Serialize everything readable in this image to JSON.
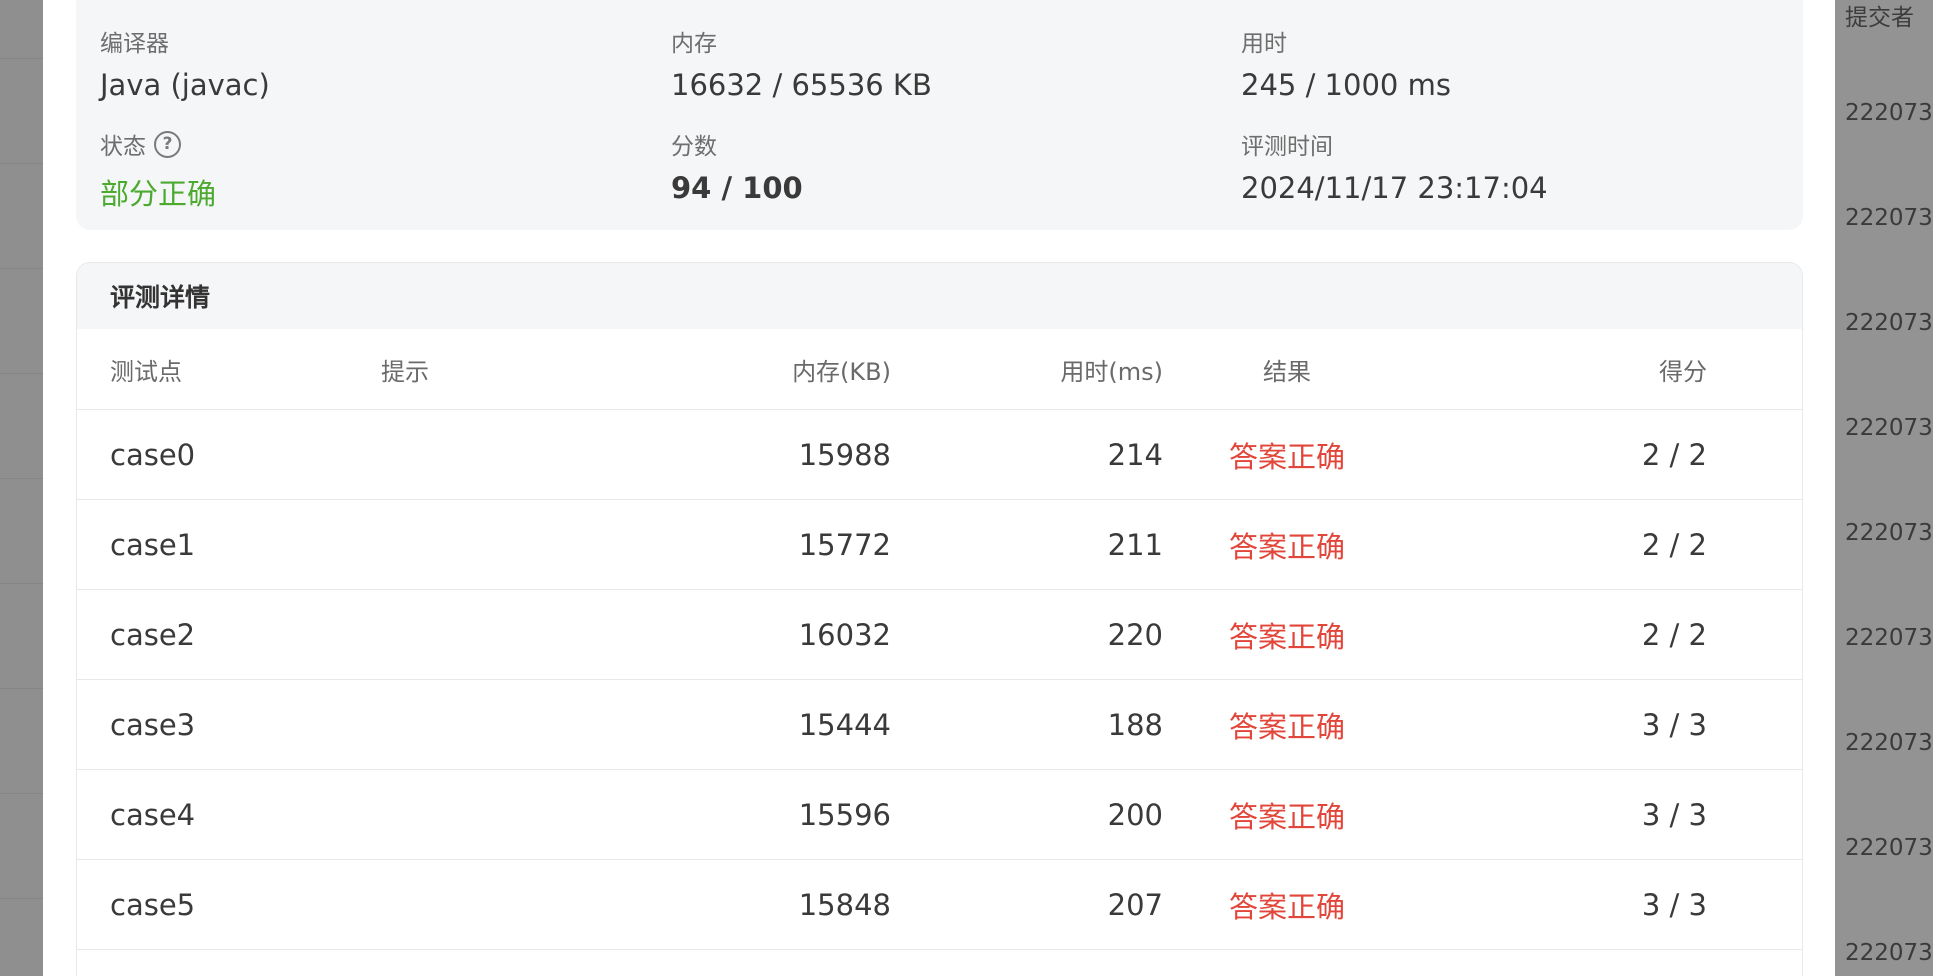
{
  "background": {
    "column_header": "提交者",
    "row_ids": [
      "222073",
      "222073",
      "222073",
      "222073",
      "222073",
      "222073",
      "222073",
      "222073",
      "222073"
    ]
  },
  "summary": {
    "compiler_label": "编译器",
    "compiler_value": "Java (javac)",
    "memory_label": "内存",
    "memory_value": "16632 / 65536 KB",
    "time_label": "用时",
    "time_value": "245 / 1000 ms",
    "status_label": "状态",
    "status_value": "部分正确",
    "score_label": "分数",
    "score_value": "94 / 100",
    "judge_time_label": "评测时间",
    "judge_time_value": "2024/11/17 23:17:04"
  },
  "details": {
    "title": "评测详情",
    "columns": {
      "case": "测试点",
      "hint": "提示",
      "memory": "内存(KB)",
      "time": "用时(ms)",
      "result": "结果",
      "score": "得分"
    },
    "rows": [
      {
        "case": "case0",
        "hint": "",
        "memory": "15988",
        "time": "214",
        "result": "答案正确",
        "score": "2 / 2"
      },
      {
        "case": "case1",
        "hint": "",
        "memory": "15772",
        "time": "211",
        "result": "答案正确",
        "score": "2 / 2"
      },
      {
        "case": "case2",
        "hint": "",
        "memory": "16032",
        "time": "220",
        "result": "答案正确",
        "score": "2 / 2"
      },
      {
        "case": "case3",
        "hint": "",
        "memory": "15444",
        "time": "188",
        "result": "答案正确",
        "score": "3 / 3"
      },
      {
        "case": "case4",
        "hint": "",
        "memory": "15596",
        "time": "200",
        "result": "答案正确",
        "score": "3 / 3"
      },
      {
        "case": "case5",
        "hint": "",
        "memory": "15848",
        "time": "207",
        "result": "答案正确",
        "score": "3 / 3"
      }
    ]
  },
  "colors": {
    "partial_correct": "#4caa2f",
    "answer_correct": "#e2463a"
  }
}
